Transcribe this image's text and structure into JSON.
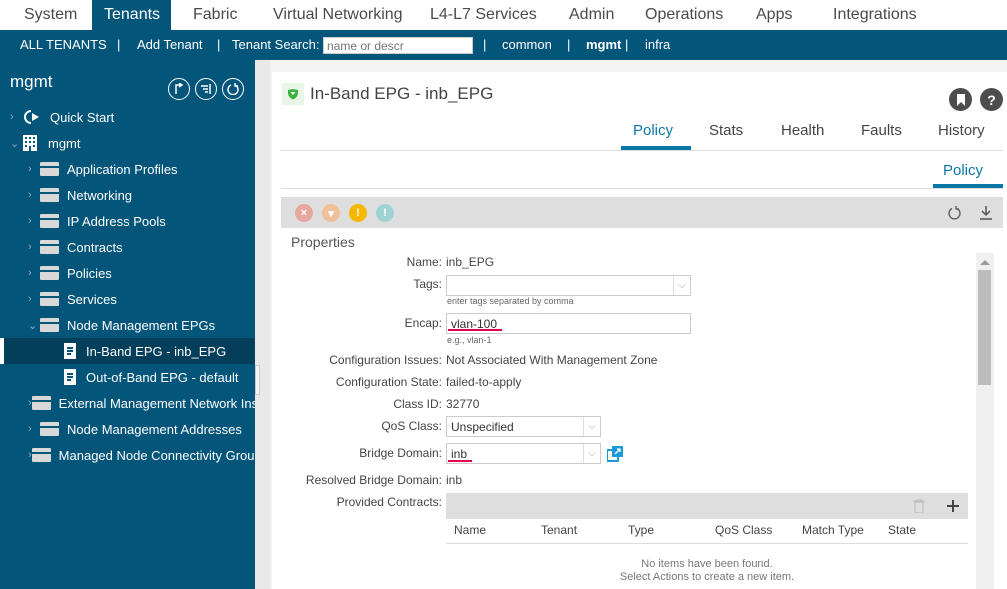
{
  "topnav": {
    "tabs": [
      {
        "label": "System",
        "active": false
      },
      {
        "label": "Tenants",
        "active": true
      },
      {
        "label": "Fabric",
        "active": false
      },
      {
        "label": "Virtual Networking",
        "active": false
      },
      {
        "label": "L4-L7 Services",
        "active": false
      },
      {
        "label": "Admin",
        "active": false
      },
      {
        "label": "Operations",
        "active": false
      },
      {
        "label": "Apps",
        "active": false
      },
      {
        "label": "Integrations",
        "active": false
      }
    ]
  },
  "subnav": {
    "all_tenants": "ALL TENANTS",
    "sep": "|",
    "add_tenant": "Add Tenant",
    "search_label": "Tenant Search:",
    "search_placeholder": "name or descr",
    "common": "common",
    "mgmt": "mgmt",
    "infra": "infra"
  },
  "sidebar": {
    "title": "mgmt",
    "items": [
      {
        "label": "Quick Start",
        "level": 0,
        "icon": "quick-start-icon",
        "expanded": false
      },
      {
        "label": "mgmt",
        "level": 0,
        "icon": "building-icon",
        "expanded": true
      },
      {
        "label": "Application Profiles",
        "level": 1,
        "icon": "folder-icon",
        "expanded": false
      },
      {
        "label": "Networking",
        "level": 1,
        "icon": "folder-icon",
        "expanded": false
      },
      {
        "label": "IP Address Pools",
        "level": 1,
        "icon": "folder-icon",
        "expanded": false
      },
      {
        "label": "Contracts",
        "level": 1,
        "icon": "folder-icon",
        "expanded": false
      },
      {
        "label": "Policies",
        "level": 1,
        "icon": "folder-icon",
        "expanded": false
      },
      {
        "label": "Services",
        "level": 1,
        "icon": "folder-icon",
        "expanded": false
      },
      {
        "label": "Node Management EPGs",
        "level": 1,
        "icon": "folder-icon",
        "expanded": true
      },
      {
        "label": "In-Band EPG - inb_EPG",
        "level": 2,
        "icon": "document-icon",
        "selected": true
      },
      {
        "label": "Out-of-Band EPG - default",
        "level": 2,
        "icon": "document-icon"
      },
      {
        "label": "External Management Network Instance Profiles",
        "level": 1,
        "icon": "folder-icon",
        "expanded": false
      },
      {
        "label": "Node Management Addresses",
        "level": 1,
        "icon": "folder-icon",
        "expanded": false
      },
      {
        "label": "Managed Node Connectivity Groups",
        "level": 1,
        "icon": "folder-icon",
        "expanded": false
      }
    ]
  },
  "main": {
    "title": "In-Band EPG - inb_EPG",
    "tabs": [
      {
        "label": "Policy",
        "active": true
      },
      {
        "label": "Stats",
        "active": false
      },
      {
        "label": "Health",
        "active": false
      },
      {
        "label": "Faults",
        "active": false
      },
      {
        "label": "History",
        "active": false
      }
    ],
    "subtab": "Policy",
    "properties_heading": "Properties",
    "fields": {
      "name_label": "Name:",
      "name_value": "inb_EPG",
      "tags_label": "Tags:",
      "tags_value": "",
      "tags_hint": "enter tags separated by comma",
      "encap_label": "Encap:",
      "encap_value": "vlan-100",
      "encap_hint": "e.g., vlan-1",
      "config_issues_label": "Configuration Issues:",
      "config_issues_value": "Not Associated With Management Zone",
      "config_state_label": "Configuration State:",
      "config_state_value": "failed-to-apply",
      "class_id_label": "Class ID:",
      "class_id_value": "32770",
      "qos_label": "QoS Class:",
      "qos_value": "Unspecified",
      "bd_label": "Bridge Domain:",
      "bd_value": "inb",
      "resolved_bd_label": "Resolved Bridge Domain:",
      "resolved_bd_value": "inb",
      "provided_contracts_label": "Provided Contracts:"
    },
    "contracts_table": {
      "columns": [
        "Name",
        "Tenant",
        "Type",
        "QoS Class",
        "Match Type",
        "State"
      ],
      "empty_line1": "No items have been found.",
      "empty_line2": "Select Actions to create a new item."
    },
    "fault_colors": {
      "critical": "#e8a79d",
      "major": "#f0c09a",
      "minor": "#f5b800",
      "warning": "#9fd3d3"
    },
    "accent": "#0b77a8",
    "nav_color": "#04557a"
  }
}
